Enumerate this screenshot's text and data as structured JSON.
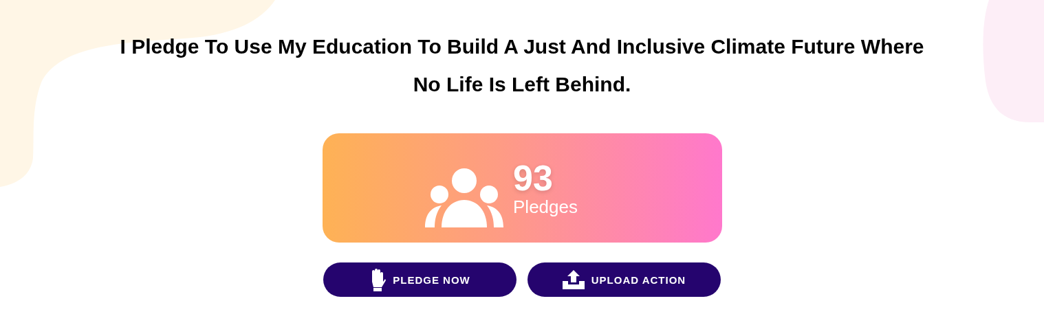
{
  "heading": "I Pledge To Use My Education To Build A Just And Inclusive Climate Future Where No Life Is Left Behind.",
  "counter": {
    "value": "93",
    "label": "Pledges"
  },
  "buttons": [
    {
      "label": "PLEDGE NOW",
      "kind": "hand"
    },
    {
      "label": "UPLOAD ACTION",
      "kind": "upload"
    }
  ]
}
